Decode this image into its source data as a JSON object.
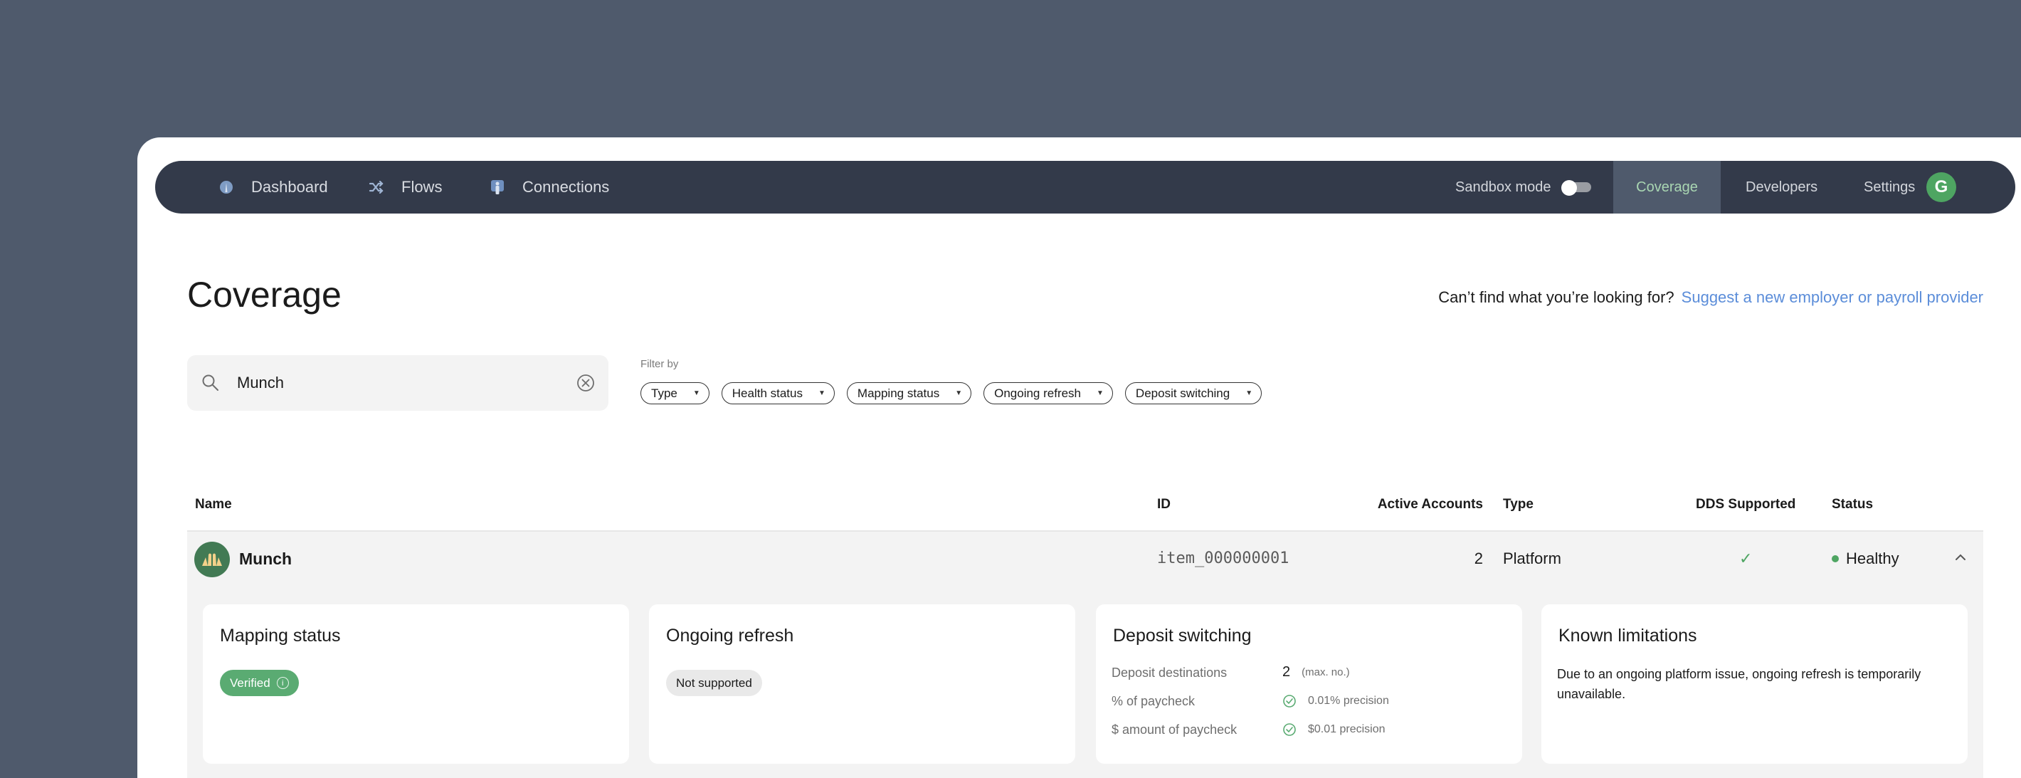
{
  "nav": {
    "left": [
      {
        "label": "Dashboard",
        "icon": "dashboard-icon"
      },
      {
        "label": "Flows",
        "icon": "shuffle-icon"
      },
      {
        "label": "Connections",
        "icon": "connections-icon"
      }
    ],
    "sandbox_label": "Sandbox mode",
    "sandbox_on": false,
    "right": [
      {
        "label": "Coverage",
        "active": true
      },
      {
        "label": "Developers",
        "active": false
      },
      {
        "label": "Settings",
        "active": false
      }
    ],
    "avatar_initial": "G",
    "colors": {
      "bar": "#333a4a",
      "active_tab_bg": "#4f5a6c",
      "active_tab_text": "#a9d6b2",
      "avatar": "#4ea562"
    }
  },
  "page": {
    "title": "Coverage",
    "help_text": "Can’t find what you’re looking for?",
    "help_link": "Suggest a new employer or payroll provider",
    "link_color": "#5b8dd9"
  },
  "search": {
    "value": "Munch",
    "placeholder": "Search"
  },
  "filters": {
    "label": "Filter by",
    "chips": [
      "Type",
      "Health status",
      "Mapping status",
      "Ongoing refresh",
      "Deposit switching"
    ]
  },
  "table": {
    "columns": [
      "Name",
      "ID",
      "Active Accounts",
      "Type",
      "DDS Supported",
      "Status"
    ],
    "rows": [
      {
        "name": "Munch",
        "id": "item_000000001",
        "active_accounts": "2",
        "type": "Platform",
        "dds_supported": "✓",
        "status": "Healthy",
        "status_color": "#4ea562",
        "expanded": true
      }
    ]
  },
  "details": {
    "mapping": {
      "title": "Mapping status",
      "badge": "Verified",
      "info": "i"
    },
    "refresh": {
      "title": "Ongoing refresh",
      "badge": "Not supported"
    },
    "deposit": {
      "title": "Deposit switching",
      "rows": [
        {
          "label": "Deposit destinations",
          "value": "2",
          "note": "(max. no.)"
        },
        {
          "label": "% of paycheck",
          "value": "0.01% precision",
          "supported": true
        },
        {
          "label": "$ amount of paycheck",
          "value": "$0.01 precision",
          "supported": true
        }
      ]
    },
    "limitations": {
      "title": "Known limitations",
      "text": "Due to an ongoing platform issue, ongoing refresh is temporarily unavailable."
    }
  }
}
